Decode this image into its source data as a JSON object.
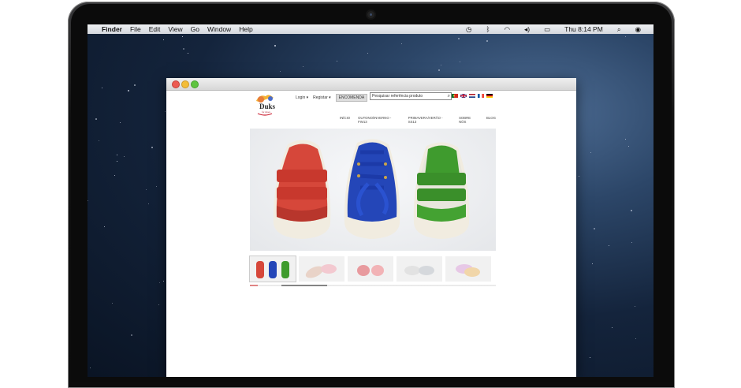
{
  "menubar": {
    "apple": "",
    "items": [
      "Finder",
      "File",
      "Edit",
      "View",
      "Go",
      "Window",
      "Help"
    ],
    "clock": "Thu 8:14 PM"
  },
  "site": {
    "logo_text": "Duks",
    "logo_sub": "for shoes",
    "login": "Login ▾",
    "register": "Registar ▾",
    "order": "ENCOMENDA",
    "search_placeholder": "Pesquisar referência produto",
    "nav": [
      "INÍCIO",
      "OUTONO/INVERNO - FW13",
      "PRIMAVERA/VERÃO - SS13",
      "SOBRE NÓS",
      "BLOG"
    ]
  },
  "colors": {
    "accent_red": "#d6473a",
    "accent_blue": "#2446b8",
    "accent_green": "#3f9b2e"
  }
}
